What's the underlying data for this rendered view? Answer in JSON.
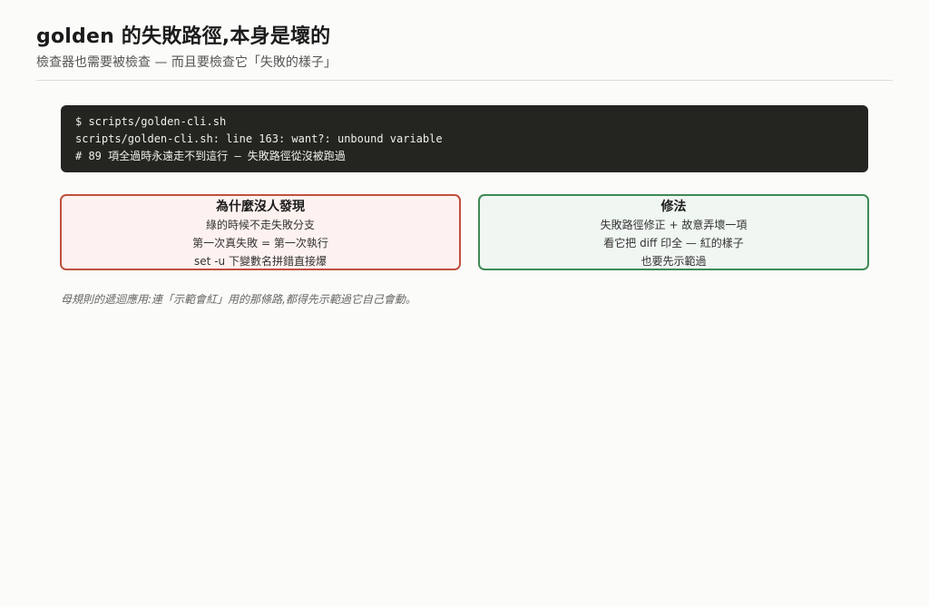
{
  "page": {
    "title": "golden 的失敗路徑,本身是壞的",
    "subtitle": "檢查器也需要被檢查 — 而且要檢查它「失敗的樣子」"
  },
  "terminal": {
    "lines": [
      "$ scripts/golden-cli.sh",
      "scripts/golden-cli.sh: line 163: want?: unbound variable",
      "# 89 項全過時永遠走不到這行 — 失敗路徑從沒被跑過"
    ]
  },
  "cards": {
    "why": {
      "title": "為什麼沒人發現",
      "lines": [
        "綠的時候不走失敗分支",
        "第一次真失敗 = 第一次執行",
        "set -u 下變數名拼錯直接爆"
      ]
    },
    "fix": {
      "title": "修法",
      "lines": [
        "失敗路徑修正 + 故意弄壞一項",
        "看它把 diff 印全 — 紅的樣子",
        "也要先示範過"
      ]
    }
  },
  "footnote": "母規則的遞迴應用:連「示範會紅」用的那條路,都得先示範過它自己會動。",
  "colors": {
    "terminal_bg": "#242521",
    "why_border": "#c0503f",
    "why_bg": "#fdf2ef",
    "fix_border": "#3e8a55",
    "fix_bg": "#f0f6f2"
  }
}
